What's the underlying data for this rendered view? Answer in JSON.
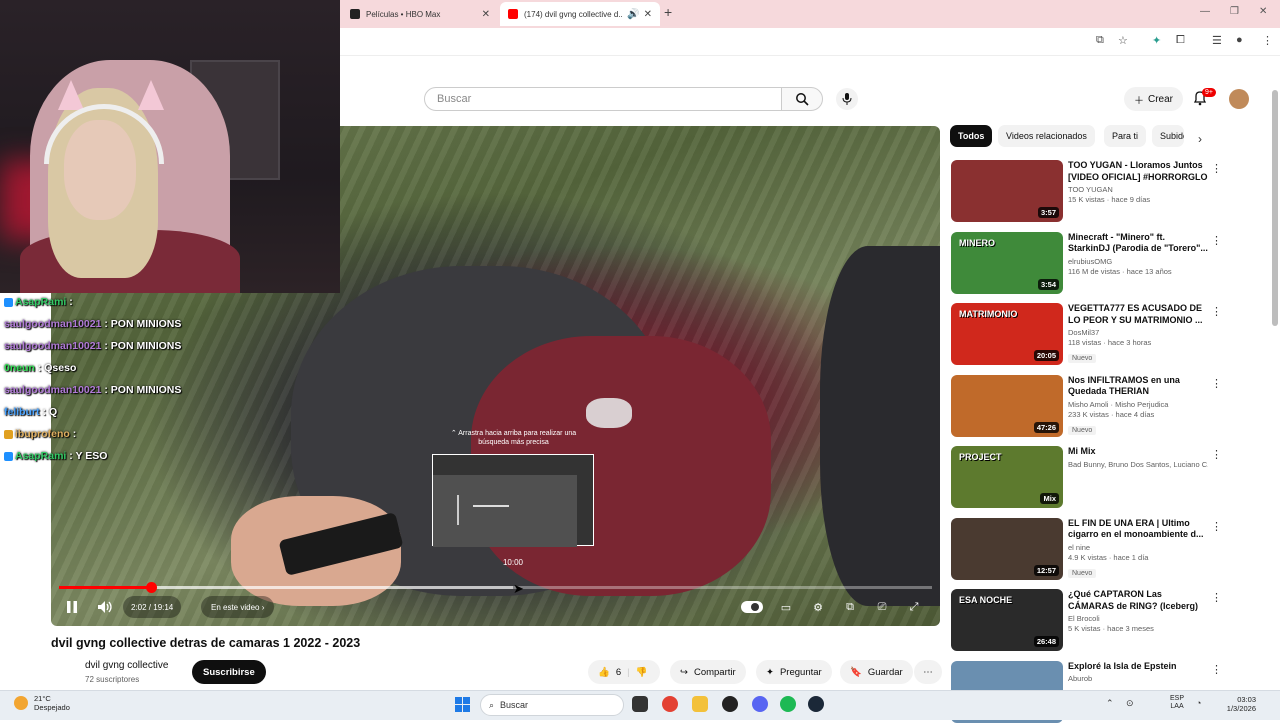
{
  "browser": {
    "tabs": [
      {
        "title": "Películas • HBO Max",
        "favicon_color": "#222222"
      },
      {
        "title": "(174) dvil gvng collective d...",
        "favicon_color": "#ff0000"
      }
    ],
    "icons": [
      "new-tab-icon",
      "minimize-icon",
      "restore-icon",
      "close-icon"
    ]
  },
  "youtube": {
    "search_placeholder": "Buscar",
    "create_label": "Crear",
    "notifications_badge": "9+"
  },
  "player": {
    "hint_text": "⌃ Arrastra hacia arriba para realizar una búsqueda más precisa",
    "preview_time": "10:00",
    "time": "2:02 / 19:14",
    "chapter": "En este video",
    "progress_played": 0.105,
    "progress_buffer": 0.52
  },
  "chat": [
    {
      "user": "AsapRami",
      "text": "",
      "color": "#33cc66",
      "badge": "#1e90ff"
    },
    {
      "user": "saulgoodman10021",
      "text": "PON MINIONS",
      "color": "#b07ad6",
      "badge": ""
    },
    {
      "user": "saulgoodman10021",
      "text": "PON MINIONS",
      "color": "#b07ad6",
      "badge": ""
    },
    {
      "user": "0neun",
      "text": "Qseso",
      "color": "#33dd55",
      "badge": ""
    },
    {
      "user": "saulgoodman10021",
      "text": "PON MINIONS",
      "color": "#b07ad6",
      "badge": ""
    },
    {
      "user": "feliburt",
      "text": "Q",
      "color": "#4aa3ff",
      "badge": ""
    },
    {
      "user": "ibuprofeno",
      "text": "",
      "color": "#e0b060",
      "badge": "#e0a020"
    },
    {
      "user": "AsapRami",
      "text": "Y ESO",
      "color": "#33cc66",
      "badge": "#1e90ff"
    }
  ],
  "video": {
    "title": "dvil gvng collective detras de camaras 1 2022 - 2023",
    "channel": "dvil gvng collective",
    "subscribers": "72 suscriptores",
    "subscribe_label": "Suscribirse",
    "likes": "6",
    "share_label": "Compartir",
    "ask_label": "Preguntar",
    "save_label": "Guardar"
  },
  "sidebar": {
    "chips": [
      "Todos",
      "Videos relacionados",
      "Para ti",
      "Subidos"
    ],
    "recommendations": [
      {
        "title": "TOO YUGAN - Lloramos Juntos [VIDEO OFICIAL] #HORRORGLO",
        "channel": "TOO YUGAN",
        "meta": "15 K vistas · hace 9 días",
        "duration": "3:57",
        "nuevo": "",
        "thumb_color": "#8a3030",
        "thumb_text": ""
      },
      {
        "title": "Minecraft - \"Minero\" ft. StarkinDJ (Parodia de \"Torero\"...",
        "channel": "elrubiusOMG",
        "meta": "116 M de vistas · hace 13 años",
        "duration": "3:54",
        "nuevo": "",
        "thumb_color": "#3f8a3a",
        "thumb_text": "MINERO"
      },
      {
        "title": "VEGETTA777 ES ACUSADO DE LO PEOR Y SU MATRIMONIO ...",
        "channel": "DosMil37",
        "meta": "118 vistas · hace 3 horas",
        "duration": "20:05",
        "nuevo": "Nuevo",
        "thumb_color": "#d0281c",
        "thumb_text": "MATRIMONIO"
      },
      {
        "title": "Nos INFILTRAMOS en una Quedada THERIAN",
        "channel": "Misho Amoli · Misho Perjudica",
        "meta": "233 K vistas · hace 4 días",
        "duration": "47:26",
        "nuevo": "Nuevo",
        "thumb_color": "#c06a2a",
        "thumb_text": ""
      },
      {
        "title": "Mi Mix",
        "channel": "Bad Bunny, Bruno Dos Santos, Luciano C...",
        "meta": "",
        "duration": "Mix",
        "nuevo": "",
        "thumb_color": "#5d7a2e",
        "thumb_text": "PROJECT"
      },
      {
        "title": "EL FIN DE UNA ERA | Ultimo cigarro en el monoambiente d...",
        "channel": "el nine",
        "meta": "4.9 K vistas · hace 1 día",
        "duration": "12:57",
        "nuevo": "Nuevo",
        "thumb_color": "#4a3a30",
        "thumb_text": ""
      },
      {
        "title": "¿Qué CAPTARON Las CÁMARAS de RING? (Iceberg)",
        "channel": "El Brocoli",
        "meta": "5 K vistas · hace 3 meses",
        "duration": "26:48",
        "nuevo": "",
        "thumb_color": "#2a2a2a",
        "thumb_text": "ESA NOCHE"
      },
      {
        "title": "Exploré la Isla de Epstein",
        "channel": "Aburob",
        "meta": "",
        "duration": "",
        "nuevo": "",
        "thumb_color": "#6a8fb0",
        "thumb_text": ""
      }
    ]
  },
  "taskbar": {
    "weather_temp": "21°C",
    "weather_desc": "Despejado",
    "search_label": "Buscar",
    "lang_1": "ESP",
    "lang_2": "LAA",
    "time": "03:03",
    "date": "1/3/2026"
  }
}
